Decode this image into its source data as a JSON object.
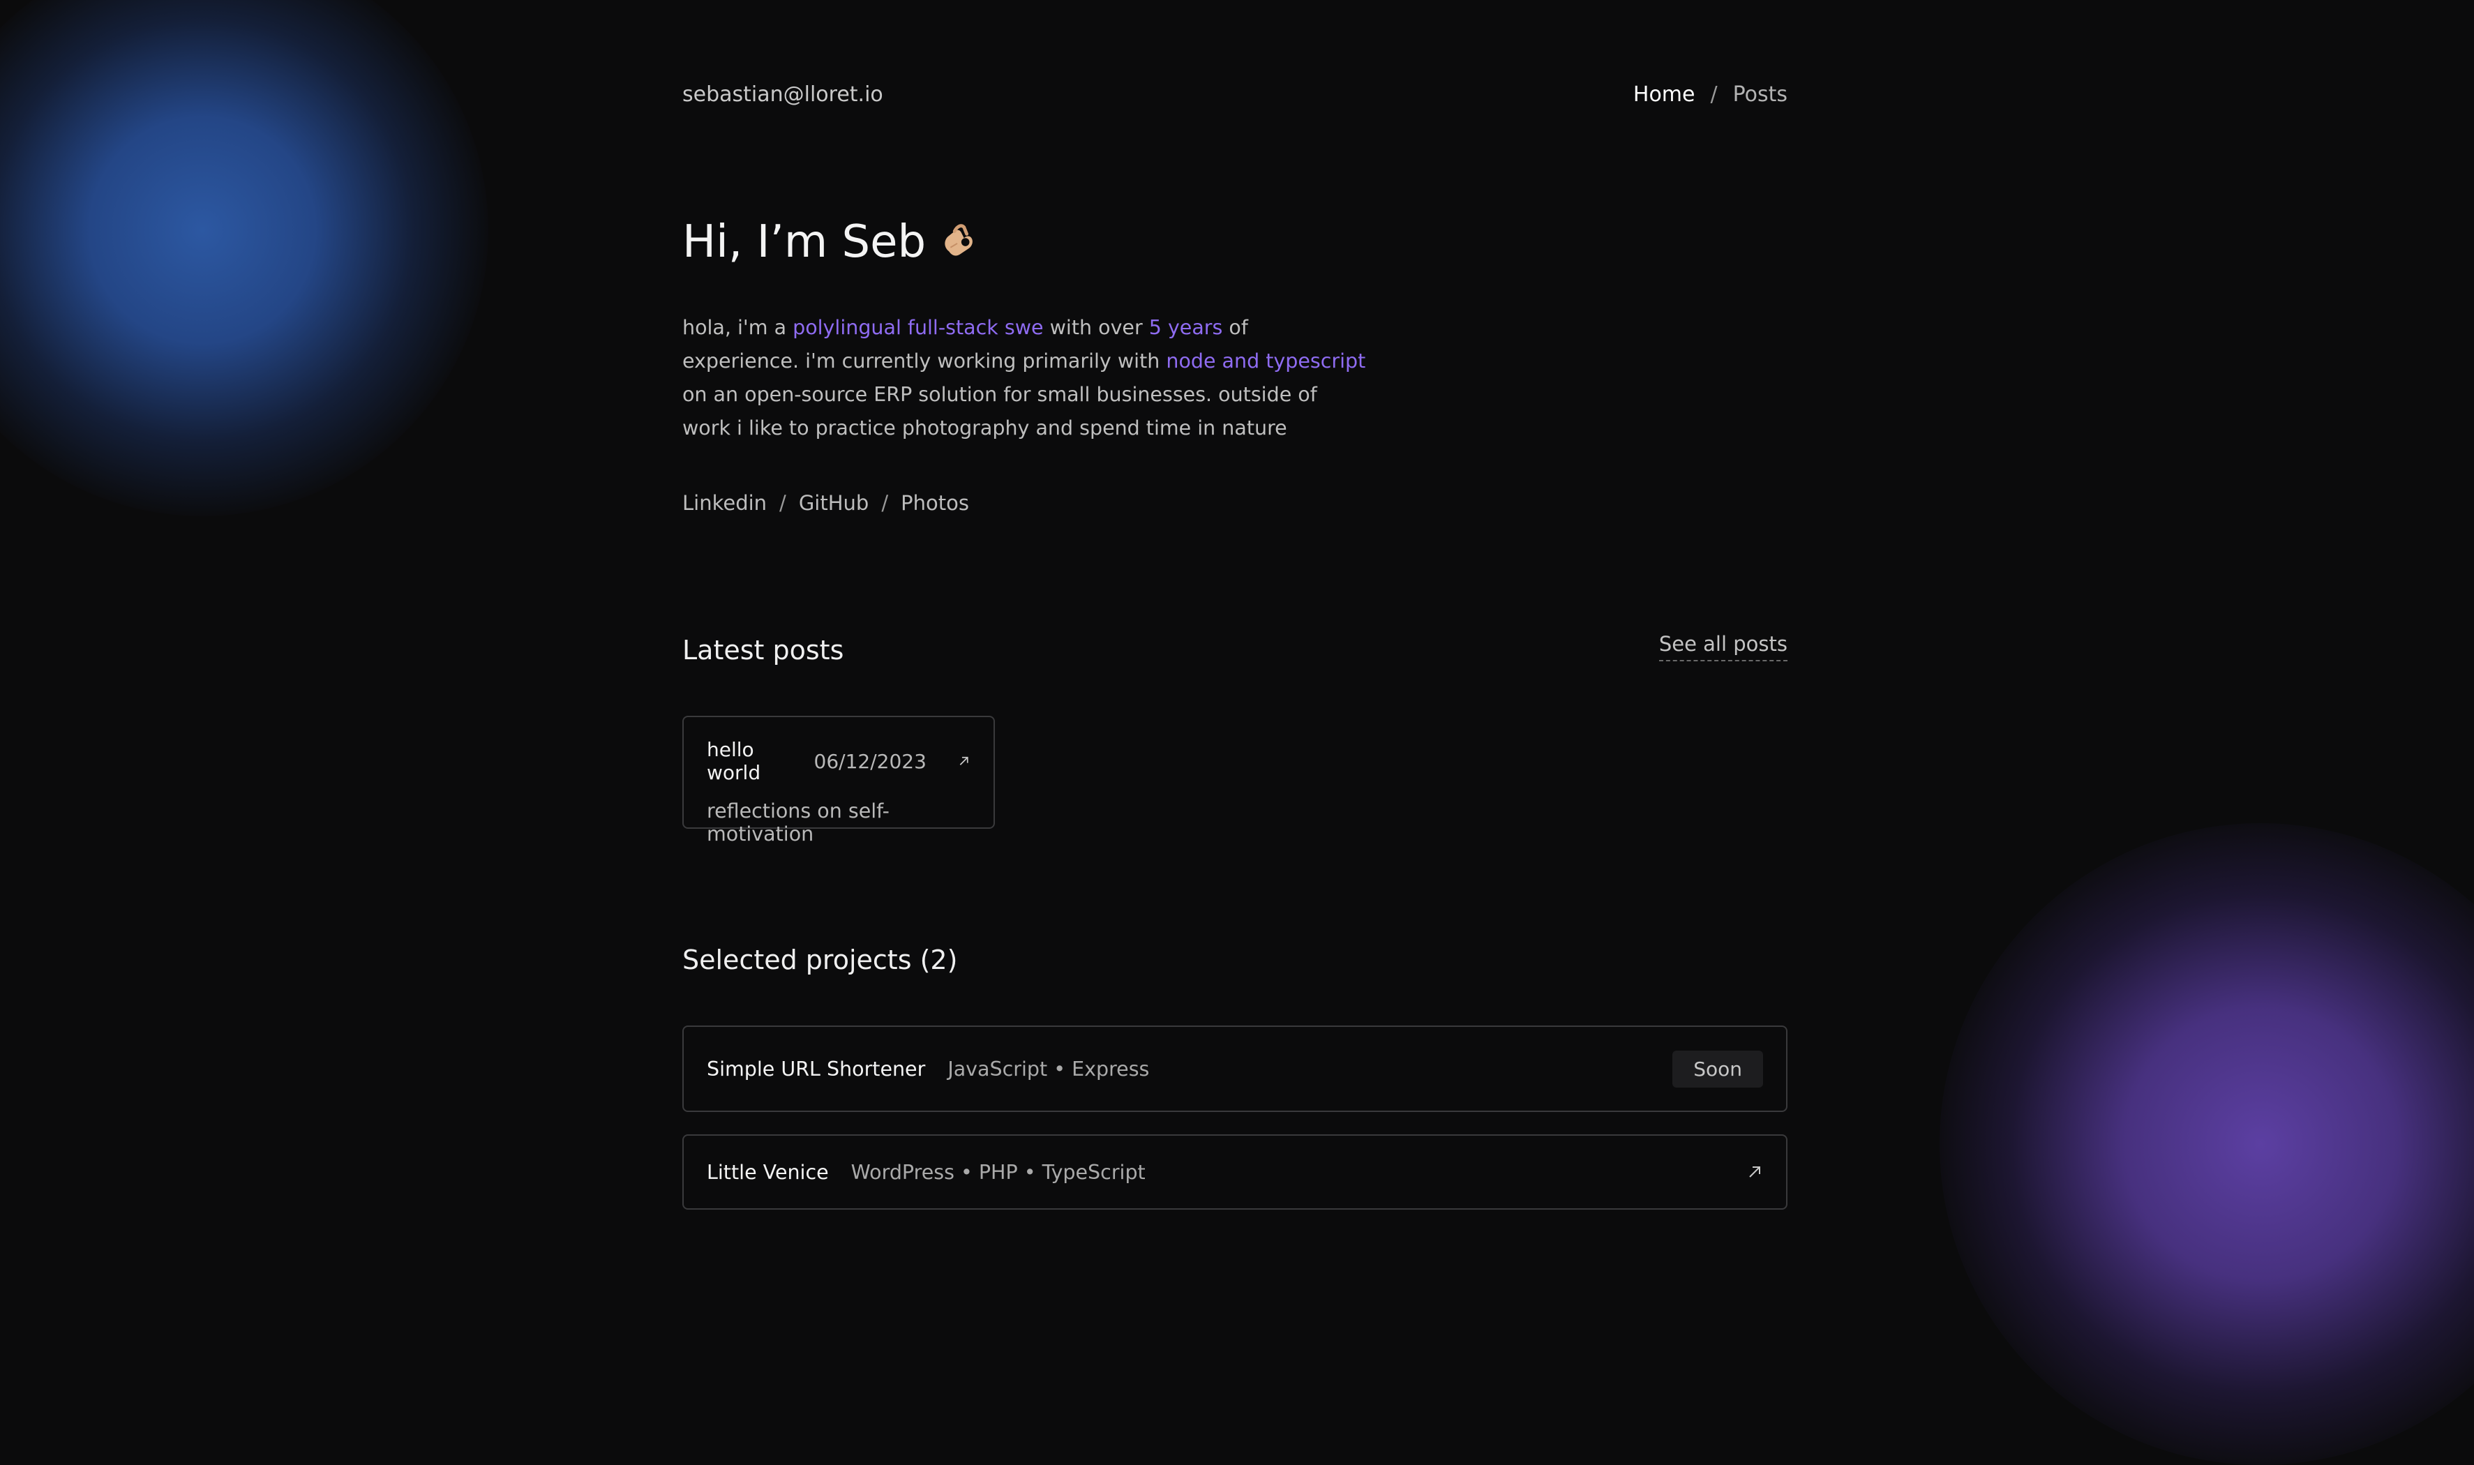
{
  "header": {
    "email": "sebastian@lloret.io",
    "nav": {
      "home": "Home",
      "separator": "/",
      "posts": "Posts"
    }
  },
  "hero": {
    "title": "Hi, I’m Seb",
    "emoji_icon": "ok-hand-icon",
    "intro": {
      "t1": "hola, i'm a ",
      "a1": "polylingual full-stack swe",
      "t2": " with over ",
      "a2": "5 years",
      "t3": " of experience. i'm currently working primarily with ",
      "a3": "node and typescript",
      "t4": " on an open-source ERP solution for small businesses. outside of work i like to practice photography and spend time in nature"
    },
    "accent_color": "#8f6cf2"
  },
  "socials": {
    "items": [
      "Linkedin",
      "GitHub",
      "Photos"
    ],
    "separator": "/"
  },
  "latest_posts": {
    "title": "Latest posts",
    "see_all": "See all posts",
    "posts": [
      {
        "title": "hello world",
        "date": "06/12/2023",
        "subtitle": "reflections on self-motivation",
        "icon": "arrow-up-right-icon"
      }
    ]
  },
  "projects": {
    "title": "Selected projects (2)",
    "items": [
      {
        "name": "Simple URL Shortener",
        "tags": "JavaScript • Express",
        "badge": "Soon"
      },
      {
        "name": "Little Venice",
        "tags": "WordPress • PHP • TypeScript",
        "icon": "arrow-up-right-icon"
      }
    ]
  },
  "colors": {
    "background": "#0b0b0c",
    "blob_blue": "#2e5caa",
    "blob_purple": "#6042aa"
  }
}
